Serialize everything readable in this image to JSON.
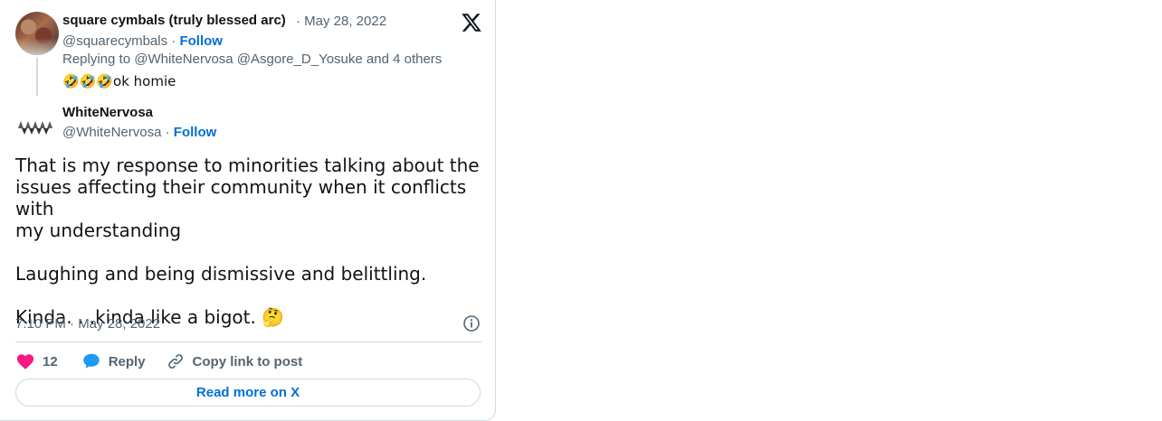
{
  "parent_tweet": {
    "name": "square cymbals (truly blessed arc)",
    "date": "· May 28, 2022",
    "handle": "@squarecymbals",
    "follow_label": "Follow",
    "replying_to": "Replying to @WhiteNervosa @Asgore_D_Yosuke and 4 others",
    "text": "🤣🤣🤣ok homie"
  },
  "main_tweet": {
    "name": "WhiteNervosa",
    "handle": "@WhiteNervosa",
    "follow_label": "Follow",
    "body": "That is my response to minorities talking about the\nissues affecting their community when it conflicts with\nmy understanding\n\nLaughing and being dismissive and belittling.\n\nKinda. . .kinda like a bigot. 🤔",
    "timestamp": "7:10 PM · May 28, 2022"
  },
  "actions": {
    "like_count": "12",
    "reply_label": "Reply",
    "copy_label": "Copy link to post"
  },
  "read_more_label": "Read more on X",
  "icons": {
    "logo": "x-logo-icon",
    "like": "heart-icon",
    "reply": "speech-bubble-icon",
    "copy": "link-icon",
    "info": "info-icon"
  },
  "colors": {
    "link": "#006fd6",
    "like": "#f91880",
    "reply": "#1d9bf0",
    "muted": "#536471"
  }
}
